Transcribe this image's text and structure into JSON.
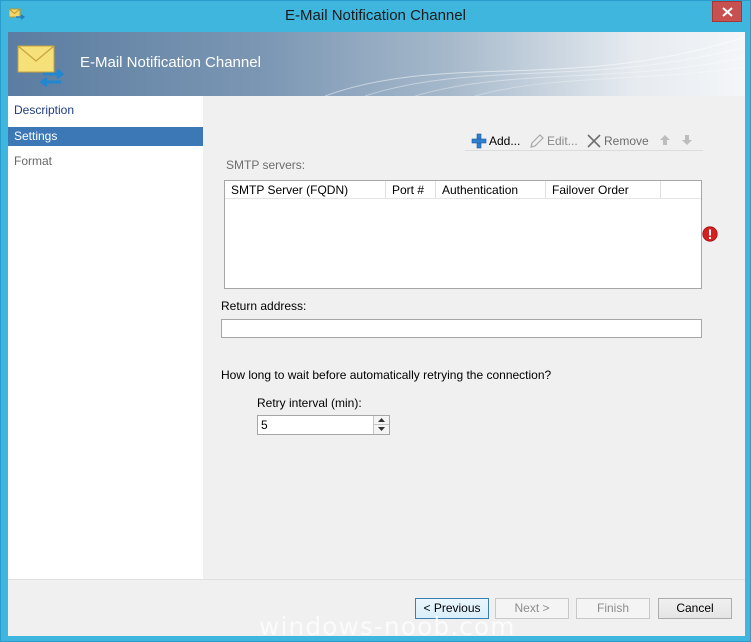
{
  "window": {
    "title": "E-Mail Notification Channel"
  },
  "banner": {
    "title": "E-Mail Notification Channel"
  },
  "sidebar": {
    "items": [
      {
        "label": "Description"
      },
      {
        "label": "Settings"
      },
      {
        "label": "Format"
      }
    ]
  },
  "toolbar": {
    "add_label": "Add...",
    "edit_label": "Edit...",
    "remove_label": "Remove"
  },
  "smtp": {
    "label": "SMTP servers:",
    "columns": [
      "SMTP Server (FQDN)",
      "Port #",
      "Authentication",
      "Failover Order"
    ]
  },
  "return_address": {
    "label": "Return address:",
    "value": ""
  },
  "retry": {
    "question": "How long to wait before automatically retrying the connection?",
    "label": "Retry interval (min):",
    "value": "5"
  },
  "footer": {
    "previous": "< Previous",
    "next": "Next >",
    "finish": "Finish",
    "cancel": "Cancel"
  },
  "watermark": "windows-noob.com",
  "colors": {
    "titlebar": "#3fb6de",
    "selected_nav": "#3c78b6",
    "error": "#d42020"
  }
}
